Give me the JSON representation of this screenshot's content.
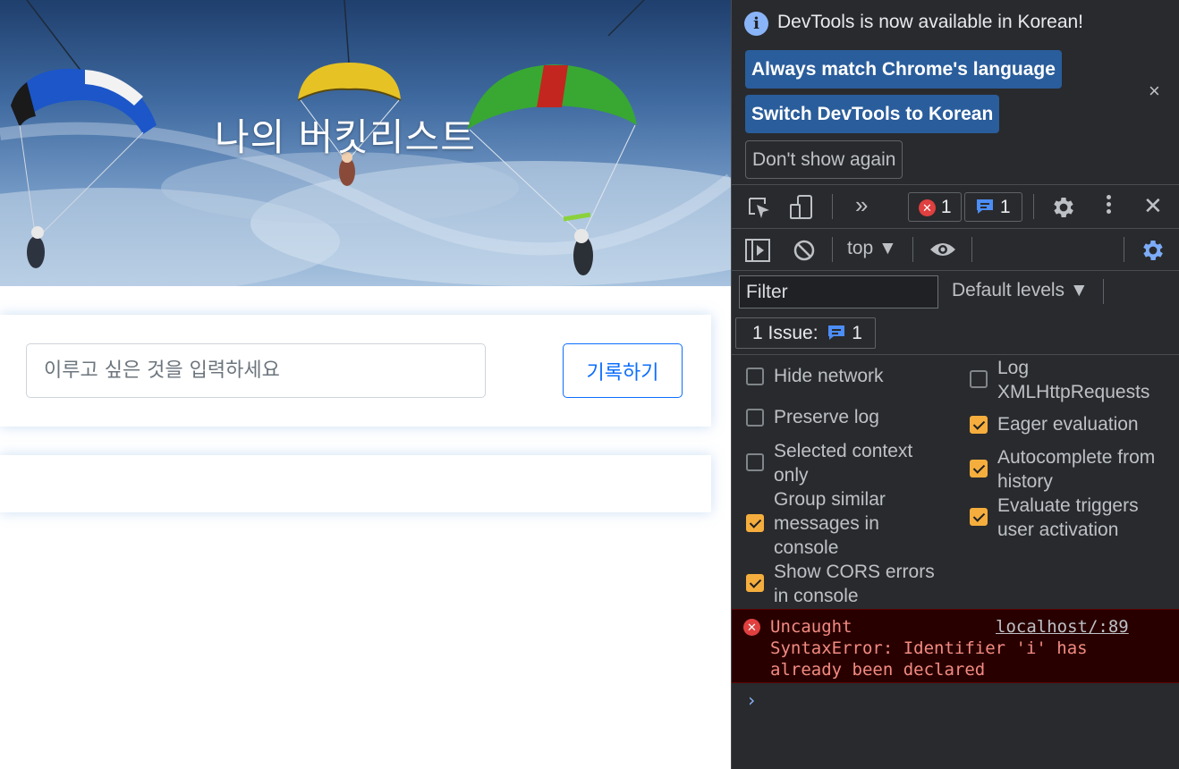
{
  "page": {
    "hero_title": "나의 버킷리스트",
    "input_placeholder": "이루고 싶은 것을 입력하세요",
    "record_button": "기록하기"
  },
  "devtools": {
    "banner": {
      "message": "DevTools is now available in Korean!",
      "always_match": "Always match Chrome's language",
      "switch_korean": "Switch DevTools to Korean",
      "dont_show": "Don't show again",
      "close": "×"
    },
    "toolbar": {
      "more_tabs": "»",
      "error_count": "1",
      "message_count": "1",
      "close": "✕"
    },
    "console_toolbar": {
      "context": "top ▼"
    },
    "filter": {
      "placeholder": "Filter",
      "levels": "Default levels ▼"
    },
    "issues": {
      "label": "1 Issue:",
      "count": "1"
    },
    "settings": {
      "hide_network": "Hide network",
      "preserve_log": "Preserve log",
      "selected_context_line1": "Selected context",
      "selected_context_line2": "only",
      "group_similar_line1": "Group similar",
      "group_similar_line2": "messages in",
      "group_similar_line3": "console",
      "show_cors_line1": "Show CORS errors",
      "show_cors_line2": "in console",
      "log_xhr_line1": "Log",
      "log_xhr_line2": "XMLHttpRequests",
      "eager_eval": "Eager evaluation",
      "autocomplete_line1": "Autocomplete from",
      "autocomplete_line2": "history",
      "eval_triggers_line1": "Evaluate triggers",
      "eval_triggers_line2": "user activation"
    },
    "settings_state": {
      "hide_network": false,
      "preserve_log": false,
      "selected_context": false,
      "group_similar": true,
      "show_cors": true,
      "log_xhr": false,
      "eager_eval": true,
      "autocomplete": true,
      "eval_triggers": true
    },
    "error": {
      "line1": "Uncaught",
      "line2": "SyntaxError: Identifier 'i' has",
      "line3": "already been declared",
      "source": "localhost/:89"
    },
    "prompt": "›"
  },
  "colors": {
    "accent_blue": "#0d6efd",
    "devtools_bg": "#292a2d",
    "checkbox_on": "#f5ae3d",
    "error_text": "#f28b82"
  }
}
